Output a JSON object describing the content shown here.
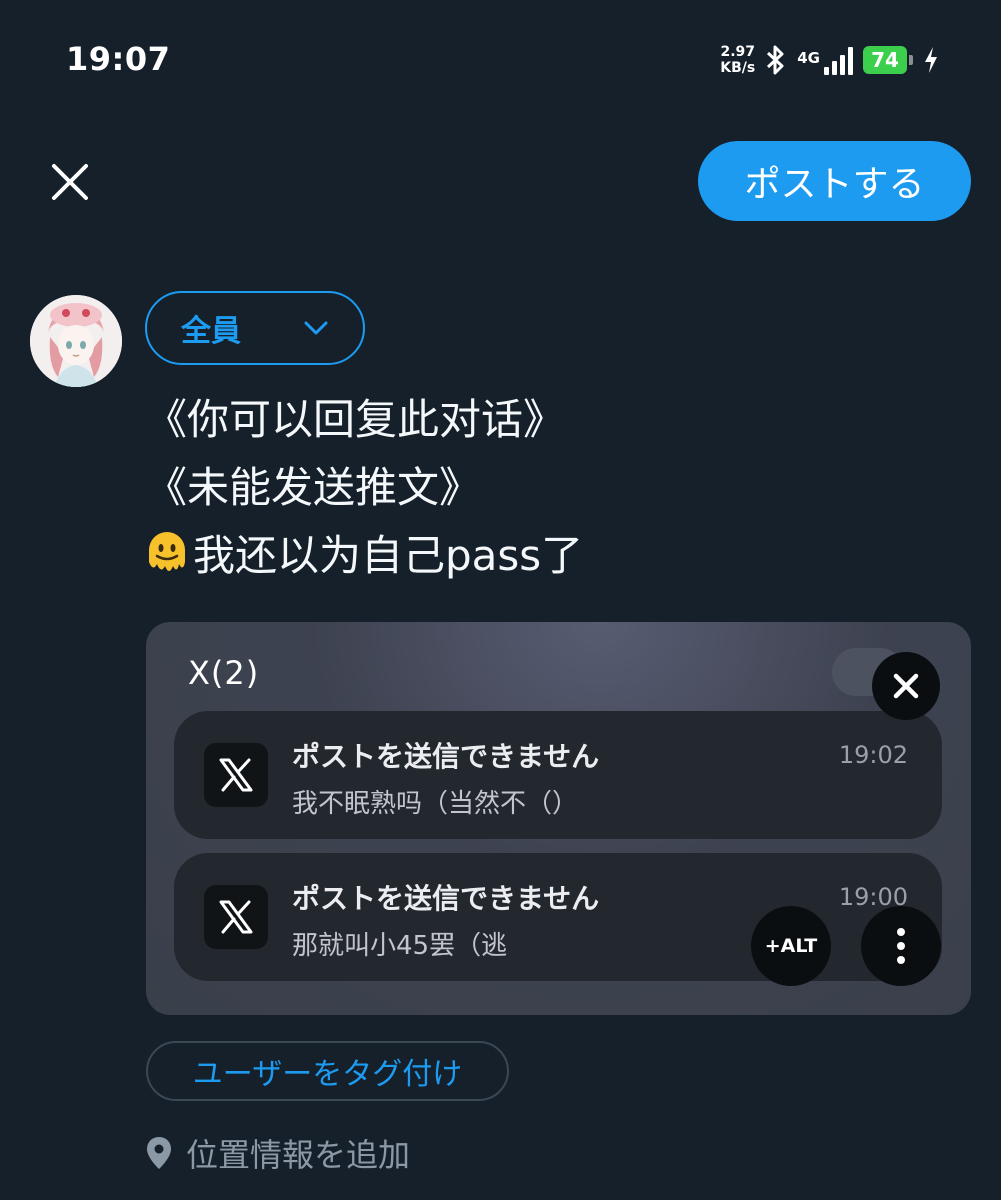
{
  "status_bar": {
    "time": "19:07",
    "net_speed_value": "2.97",
    "net_speed_unit": "KB/s",
    "network_type": "4G",
    "battery_level": "74",
    "icons": [
      "bluetooth-icon",
      "signal-icon",
      "battery-icon",
      "charging-icon"
    ]
  },
  "header": {
    "close_icon": "close-icon",
    "post_button_label": "ポストする"
  },
  "composer": {
    "audience_label": "全員",
    "lines": [
      "《你可以回复此对话》",
      "《未能发送推文》"
    ],
    "emoji_icon": "melting-face-emoji",
    "line3_text": "我还以为自己pass了"
  },
  "media": {
    "group_title": "X(2)",
    "notifications": [
      {
        "app_icon": "x-logo-icon",
        "title": "ポストを送信できません",
        "body": "我不眠熟吗（当然不（）",
        "time": "19:02"
      },
      {
        "app_icon": "x-logo-icon",
        "title": "ポストを送信できません",
        "body": "那就叫小45罢（逃",
        "time": "19:00"
      }
    ],
    "alt_button_label": "+ALT"
  },
  "footer": {
    "tag_users_label": "ユーザーをタグ付け",
    "location_label": "位置情報を追加"
  },
  "colors": {
    "background": "#15202b",
    "accent": "#1d9bf0",
    "battery": "#3ccf4e",
    "muted": "#8b98a5"
  }
}
